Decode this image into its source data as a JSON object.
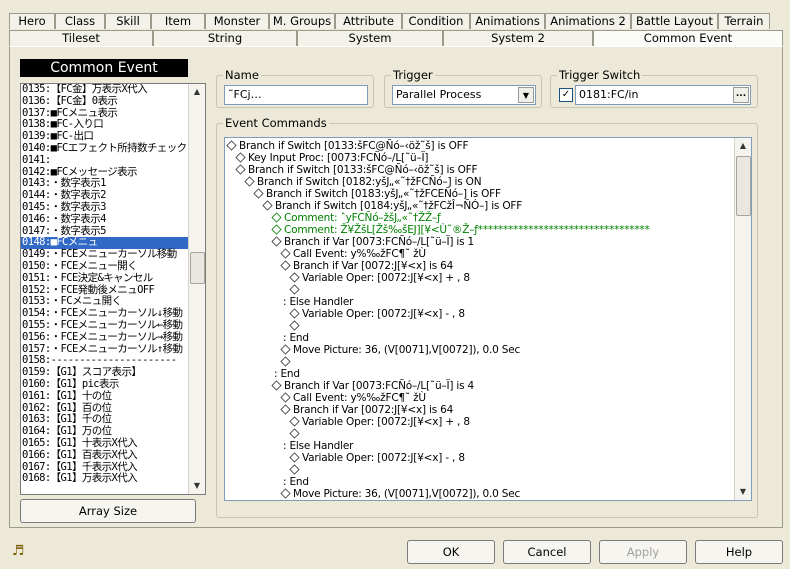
{
  "top_tabs": [
    "Hero",
    "Class",
    "Skill",
    "Item",
    "Monster",
    "M. Groups",
    "Attribute",
    "Condition",
    "Animations",
    "Animations 2",
    "Battle Layout",
    "Terrain"
  ],
  "second_tabs": [
    "Tileset",
    "String",
    "System",
    "System 2",
    "Common Event"
  ],
  "left": {
    "title": "Common Event",
    "items": [
      "0135:【FC金】万表示X代入",
      "0136:【FC金】0表示",
      "0137:■FCメニュ表示",
      "0138:■FC-入り口",
      "0139:■FC-出口",
      "0140:■FCエフェクト所持数チェック",
      "0141:",
      "0142:■FCメッセージ表示",
      "0143:・数字表示1",
      "0144:・数字表示2",
      "0145:・数字表示3",
      "0146:・数字表示4",
      "0147:・数字表示5",
      "0148:■FCメニュ",
      "0149:・FCEメニューカーソル移動",
      "0150:・FCEメニュー開く",
      "0151:・FCE決定&キャンセル",
      "0152:・FCE発動後メニュOFF",
      "0153:・FCメニュ開く",
      "0154:・FCEメニューカーソル↓移動",
      "0155:・FCEメニューカーソル←移動",
      "0156:・FCEメニューカーソル→移動",
      "0157:・FCEメニューカーソル↑移動",
      "0158:----------------------",
      "0159:【G1】スコア表示】",
      "0160:【G1】pic表示",
      "0161:【G1】十の位",
      "0162:【G1】百の位",
      "0163:【G1】千の位",
      "0164:【G1】万の位",
      "0165:【G1】十表示X代入",
      "0166:【G1】百表示X代入",
      "0167:【G1】千表示X代入",
      "0168:【G1】万表示X代入"
    ],
    "selected_index": 13,
    "array_button": "Array Size"
  },
  "name": {
    "label": "Name",
    "value": "˜FCj…"
  },
  "trigger": {
    "label": "Trigger",
    "value": "Parallel Process"
  },
  "trigger_switch": {
    "label": "Trigger Switch",
    "value": "0181:FC/in",
    "checked": true,
    "browse": "..."
  },
  "commands": {
    "label": "Event Commands",
    "lines": [
      {
        "indent": 0,
        "text": "Branch if  Switch [0133:šFC@Ñó–‹öž˜š] is OFF",
        "comment": false
      },
      {
        "indent": 1,
        "text": "Key Input Proc: [0073:FCÑó–/L[˜ü–Ï]",
        "comment": false
      },
      {
        "indent": 1,
        "text": "Branch if  Switch [0133:šFC@Ñó–‹öž˜š] is OFF",
        "comment": false
      },
      {
        "indent": 2,
        "text": "Branch if  Switch [0182:yšJ„«˜†žFCÑó–] is ON",
        "comment": false
      },
      {
        "indent": 3,
        "text": "Branch if  Switch [0183:yšJ„«˜†žFCEÑó–] is OFF",
        "comment": false
      },
      {
        "indent": 4,
        "text": "Branch if  Switch [0184:yšJ„«˜†žFCžÎ¬ÑÓ–] is OFF",
        "comment": false
      },
      {
        "indent": 5,
        "text": "Comment: ˆyFCÑó–žšJ„«˜†ŽŽ–ƒ",
        "comment": true
      },
      {
        "indent": 5,
        "text": "Comment: Ž¥ŽšL[Žš‰šEJ][¥<Ù˜®Ž–ƒ**********************************",
        "comment": true
      },
      {
        "indent": 5,
        "text": "Branch if Var [0073:FCÑó–/L[˜ü–Ï] is 1",
        "comment": false
      },
      {
        "indent": 6,
        "text": "Call Event: y%‰žFC¶˜ žÙ",
        "comment": false
      },
      {
        "indent": 6,
        "text": "Branch if Var [0072:J[¥<x] is 64",
        "comment": false
      },
      {
        "indent": 7,
        "text": "Variable Oper: [0072:J[¥<x] + , 8",
        "comment": false
      },
      {
        "indent": 7,
        "text": "",
        "comment": false
      },
      {
        "indent": 6,
        "text": ": Else Handler",
        "comment": false
      },
      {
        "indent": 7,
        "text": "Variable Oper: [0072:J[¥<x] - , 8",
        "comment": false
      },
      {
        "indent": 7,
        "text": "",
        "comment": false
      },
      {
        "indent": 6,
        "text": ": End",
        "comment": false
      },
      {
        "indent": 6,
        "text": "Move Picture: 36, (V[0071],V[0072]), 0.0 Sec",
        "comment": false
      },
      {
        "indent": 6,
        "text": "",
        "comment": false
      },
      {
        "indent": 5,
        "text": ": End",
        "comment": false
      },
      {
        "indent": 5,
        "text": "Branch if Var [0073:FCÑó–/L[˜ü–Ï] is 4",
        "comment": false
      },
      {
        "indent": 6,
        "text": "Call Event: y%‰žFC¶˜ žÙ",
        "comment": false
      },
      {
        "indent": 6,
        "text": "Branch if Var [0072:J[¥<x] is 64",
        "comment": false
      },
      {
        "indent": 7,
        "text": "Variable Oper: [0072:J[¥<x] + , 8",
        "comment": false
      },
      {
        "indent": 7,
        "text": "",
        "comment": false
      },
      {
        "indent": 6,
        "text": ": Else Handler",
        "comment": false
      },
      {
        "indent": 7,
        "text": "Variable Oper: [0072:J[¥<x] - , 8",
        "comment": false
      },
      {
        "indent": 7,
        "text": "",
        "comment": false
      },
      {
        "indent": 6,
        "text": ": End",
        "comment": false
      },
      {
        "indent": 6,
        "text": "Move Picture: 36, (V[0071],V[0072]), 0.0 Sec",
        "comment": false
      }
    ]
  },
  "footer": {
    "ok": "OK",
    "cancel": "Cancel",
    "apply": "Apply",
    "help": "Help"
  },
  "icons": {
    "music": "music-note-icon"
  }
}
